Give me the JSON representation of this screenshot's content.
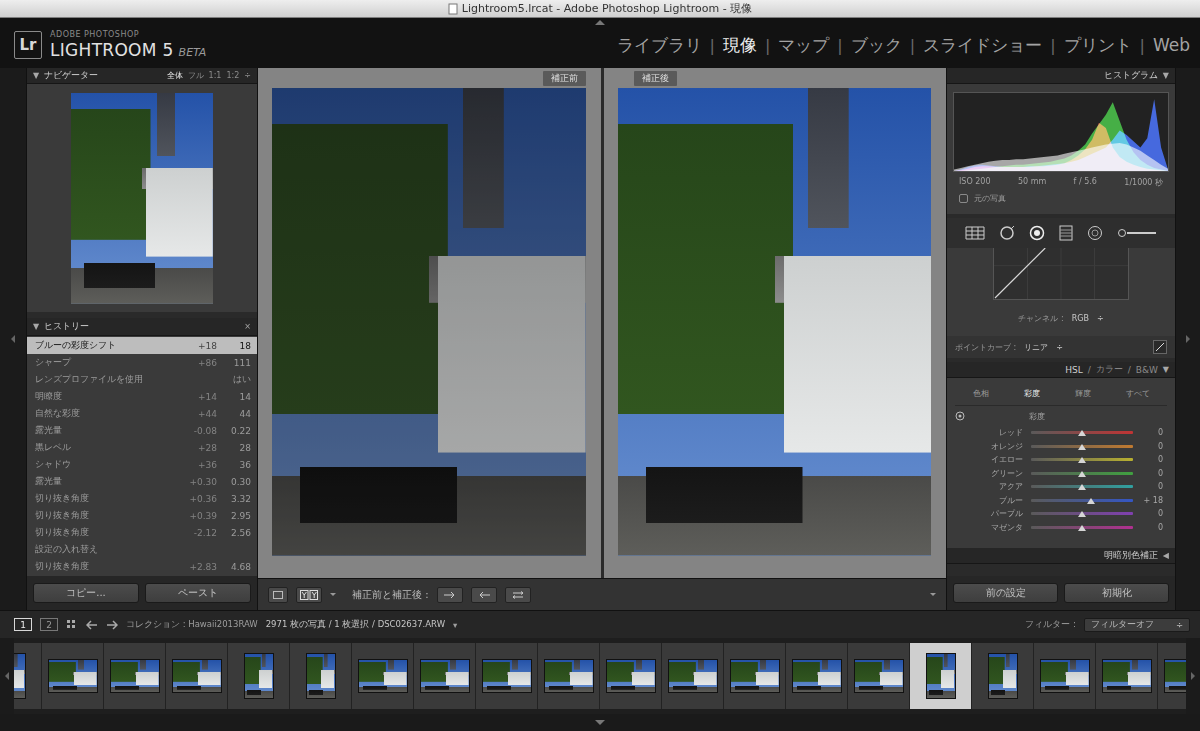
{
  "window": {
    "title": "Lightroom5.lrcat - Adobe Photoshop Lightroom - 現像"
  },
  "identity": {
    "badge": "Lr",
    "vendor": "ADOBE PHOTOSHOP",
    "product": "LIGHTROOM 5",
    "edition": "BETA"
  },
  "modules": {
    "separator": "|",
    "items": [
      {
        "label": "ライブラリ",
        "selected": false
      },
      {
        "label": "現像",
        "selected": true
      },
      {
        "label": "マップ",
        "selected": false
      },
      {
        "label": "ブック",
        "selected": false
      },
      {
        "label": "スライドショー",
        "selected": false
      },
      {
        "label": "プリント",
        "selected": false
      },
      {
        "label": "Web",
        "selected": false
      }
    ]
  },
  "navigator": {
    "toggle": "▼",
    "title": "ナビゲーター",
    "zoom": [
      {
        "label": "全体",
        "selected": true
      },
      {
        "label": "フル",
        "selected": false
      },
      {
        "label": "1:1",
        "selected": false
      },
      {
        "label": "1:2",
        "selected": false
      }
    ],
    "zoom_menu": "÷"
  },
  "history": {
    "toggle": "▼",
    "title": "ヒストリー",
    "close": "×",
    "rows": [
      {
        "name": "ブルーの彩度シフト",
        "delta": "+18",
        "value": "18",
        "selected": true
      },
      {
        "name": "シャープ",
        "delta": "+86",
        "value": "111",
        "selected": false
      },
      {
        "name": "レンズプロファイルを使用",
        "delta": "",
        "value": "はい",
        "selected": false
      },
      {
        "name": "明瞭度",
        "delta": "+14",
        "value": "14",
        "selected": false
      },
      {
        "name": "自然な彩度",
        "delta": "+44",
        "value": "44",
        "selected": false
      },
      {
        "name": "露光量",
        "delta": "-0.08",
        "value": "0.22",
        "selected": false
      },
      {
        "name": "黒レベル",
        "delta": "+28",
        "value": "28",
        "selected": false
      },
      {
        "name": "シャドウ",
        "delta": "+36",
        "value": "36",
        "selected": false
      },
      {
        "name": "露光量",
        "delta": "+0.30",
        "value": "0.30",
        "selected": false
      },
      {
        "name": "切り抜き角度",
        "delta": "+0.36",
        "value": "3.32",
        "selected": false
      },
      {
        "name": "切り抜き角度",
        "delta": "+0.39",
        "value": "2.95",
        "selected": false
      },
      {
        "name": "切り抜き角度",
        "delta": "-2.12",
        "value": "2.56",
        "selected": false
      },
      {
        "name": "設定の入れ替え",
        "delta": "",
        "value": "",
        "selected": false
      },
      {
        "name": "切り抜き角度",
        "delta": "+2.83",
        "value": "4.68",
        "selected": false
      }
    ]
  },
  "left_buttons": [
    "コピー...",
    "ペースト"
  ],
  "compare": {
    "panes": [
      {
        "label": "補正前",
        "kind": "before"
      },
      {
        "label": "補正後",
        "kind": "after"
      }
    ]
  },
  "toolbar": {
    "label": "補正前と補正後 :"
  },
  "histogram": {
    "title": "ヒストグラム",
    "toggle": "▼",
    "info": [
      "ISO 200",
      "50 mm",
      "f / 5.6",
      "1/1000 秒"
    ],
    "original_photo": {
      "label": "元の写真",
      "checked": false
    },
    "series": [
      {
        "name": "luminance",
        "color": "#b4b4b4",
        "values": [
          2,
          4,
          6,
          8,
          10,
          12,
          13,
          14,
          14,
          15,
          15,
          16,
          17,
          18,
          19,
          20,
          22,
          24,
          26,
          28,
          30,
          32,
          34,
          35,
          36,
          34,
          30,
          26,
          20,
          14,
          8,
          3
        ]
      },
      {
        "name": "red",
        "color": "#e03030",
        "values": [
          0,
          1,
          3,
          5,
          6,
          6,
          5,
          5,
          5,
          5,
          5,
          5,
          6,
          6,
          7,
          8,
          10,
          14,
          20,
          28,
          40,
          62,
          55,
          30,
          18,
          12,
          8,
          5,
          3,
          2,
          1,
          0
        ]
      },
      {
        "name": "green",
        "color": "#30c030",
        "values": [
          0,
          0,
          1,
          2,
          3,
          4,
          5,
          6,
          7,
          8,
          8,
          9,
          10,
          11,
          12,
          14,
          16,
          20,
          26,
          34,
          48,
          60,
          72,
          88,
          64,
          40,
          24,
          14,
          8,
          4,
          2,
          0
        ]
      },
      {
        "name": "blue",
        "color": "#3060ff",
        "values": [
          0,
          2,
          5,
          7,
          8,
          7,
          6,
          5,
          5,
          5,
          5,
          6,
          6,
          7,
          8,
          9,
          10,
          12,
          14,
          18,
          22,
          26,
          30,
          40,
          52,
          46,
          38,
          30,
          42,
          92,
          30,
          2
        ]
      }
    ]
  },
  "tone_curve": {
    "channel_label": "チャンネル :",
    "channel": "RGB",
    "channel_menu": "÷",
    "point_label": "ポイントカーブ :",
    "point": "リニア",
    "point_menu": "÷"
  },
  "hsl": {
    "header": [
      {
        "label": "HSL",
        "selected": true
      },
      {
        "label": "カラー",
        "selected": false
      },
      {
        "label": "B&W",
        "selected": false
      }
    ],
    "header_separator": "/",
    "toggle": "▼",
    "tabs": [
      {
        "label": "色相",
        "selected": false
      },
      {
        "label": "彩度",
        "selected": true
      },
      {
        "label": "輝度",
        "selected": false
      },
      {
        "label": "すべて",
        "selected": false
      }
    ],
    "group": "彩度",
    "sliders": [
      {
        "label": "レッド",
        "level": 0.5,
        "reading": "0",
        "color": "#c03434"
      },
      {
        "label": "オレンジ",
        "level": 0.5,
        "reading": "0",
        "color": "#c07a30"
      },
      {
        "label": "イエロー",
        "level": 0.5,
        "reading": "0",
        "color": "#b8b030"
      },
      {
        "label": "グリーン",
        "level": 0.5,
        "reading": "0",
        "color": "#40a040"
      },
      {
        "label": "アクア",
        "level": 0.5,
        "reading": "0",
        "color": "#30a0a0"
      },
      {
        "label": "ブルー",
        "level": 0.59,
        "reading": "+ 18",
        "color": "#3456c4"
      },
      {
        "label": "パープル",
        "level": 0.5,
        "reading": "0",
        "color": "#8040b0"
      },
      {
        "label": "マゼンタ",
        "level": 0.5,
        "reading": "0",
        "color": "#b03090"
      }
    ]
  },
  "split_toning": {
    "title": "明暗別色補正",
    "toggle": "◀"
  },
  "right_buttons": [
    "前の設定",
    "初期化"
  ],
  "filmstrip": {
    "pages": [
      {
        "label": "1",
        "selected": true
      },
      {
        "label": "2",
        "selected": false
      }
    ],
    "source": "コレクション : Hawaii2013RAW",
    "count": "2971 枚の写真 / 1 枚選択 / DSC02637.ARW",
    "source_menu": "▾",
    "filter_label": "フィルター :",
    "filter": "フィルターオフ",
    "filter_menu": "÷",
    "thumbs": [
      {
        "kind": "portrait",
        "selected": false
      },
      {
        "kind": "landscape",
        "selected": false
      },
      {
        "kind": "landscape",
        "selected": false
      },
      {
        "kind": "landscape",
        "selected": false
      },
      {
        "kind": "portrait",
        "selected": false
      },
      {
        "kind": "portrait",
        "selected": false
      },
      {
        "kind": "landscape",
        "selected": false
      },
      {
        "kind": "landscape",
        "selected": false
      },
      {
        "kind": "landscape",
        "selected": false
      },
      {
        "kind": "landscape",
        "selected": false
      },
      {
        "kind": "landscape",
        "selected": false
      },
      {
        "kind": "landscape",
        "selected": false
      },
      {
        "kind": "landscape",
        "selected": false
      },
      {
        "kind": "landscape",
        "selected": false
      },
      {
        "kind": "landscape",
        "selected": false
      },
      {
        "kind": "portrait",
        "selected": true
      },
      {
        "kind": "portrait",
        "selected": false
      },
      {
        "kind": "landscape",
        "selected": false
      },
      {
        "kind": "landscape",
        "selected": false
      },
      {
        "kind": "landscape",
        "selected": false
      }
    ]
  }
}
